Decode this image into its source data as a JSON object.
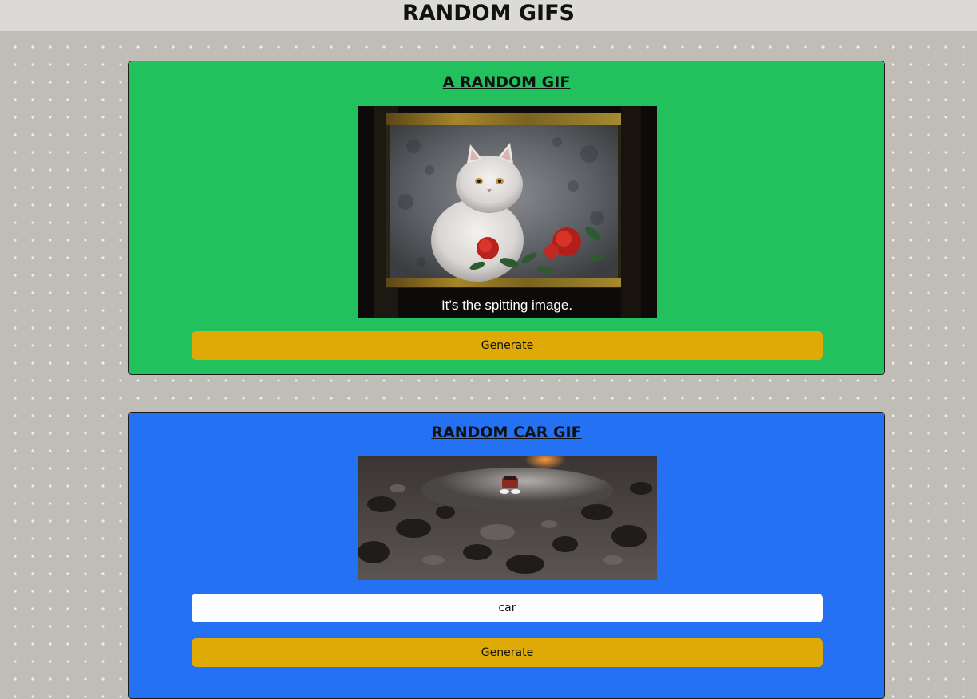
{
  "header": {
    "title": "RANDOM GIFS"
  },
  "random_card": {
    "title": "A RANDOM GIF",
    "gif_caption": "It’s the spitting image.",
    "generate_label": "Generate",
    "background_color": "#22c15e"
  },
  "tag_card": {
    "title": "RANDOM CAR GIF",
    "tag_input_value": "car",
    "generate_label": "Generate",
    "background_color": "#2471f3"
  },
  "colors": {
    "button": "#e0aa06",
    "page_background": "#c0bcb6",
    "header_background": "#dcdad6"
  }
}
